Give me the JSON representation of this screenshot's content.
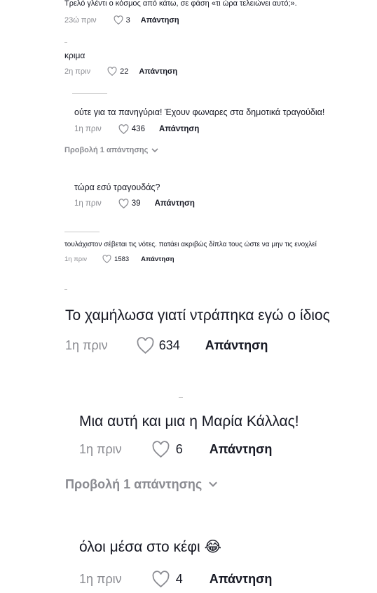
{
  "comments": [
    {
      "text": "Τρελό γλέντι ο κόσμος από κάτω, σε φάση «τι ώρα τελειώνει αυτό;».",
      "time": "23ώ πριν",
      "likes": "3",
      "reply": "Απάντηση"
    },
    {
      "text": "κριμα",
      "time": "2η πριν",
      "likes": "22",
      "reply": "Απάντηση"
    },
    {
      "text": "ούτε για τα πανηγύρια! Έχουν φωναρες στα δημοτικά τραγούδια!",
      "time": "1η πριν",
      "likes": "436",
      "reply": "Απάντηση"
    },
    {
      "text": "τώρα εσύ τραγουδάς?",
      "time": "1η πριν",
      "likes": "39",
      "reply": "Απάντηση"
    },
    {
      "text": "τουλάχιστον σέβεται τις νότες. πατάει ακριβώς δίπλα τους ώστε να μην τις ενοχλεί",
      "time": "1η πριν",
      "likes": "1583",
      "reply": "Απάντηση"
    },
    {
      "text": "Το χαμήλωσα γιατί ντράπηκα εγώ ο ίδιος",
      "time": "1η πριν",
      "likes": "634",
      "reply": "Απάντηση"
    },
    {
      "text": "Μια αυτή και μια η Μαρία Κάλλας!",
      "time": "1η πριν",
      "likes": "6",
      "reply": "Απάντηση"
    },
    {
      "text": "όλοι μέσα στο κέφι 😂",
      "time": "1η πριν",
      "likes": "4",
      "reply": "Απάντηση"
    }
  ],
  "view_replies": [
    "Προβολή 1 απάντησης",
    "Προβολή 1 απάντησης"
  ],
  "icons": {
    "like": "heart-outline-icon",
    "expand": "chevron-down-icon"
  },
  "colors": {
    "text": "#161823",
    "muted": "#8a8b91"
  }
}
